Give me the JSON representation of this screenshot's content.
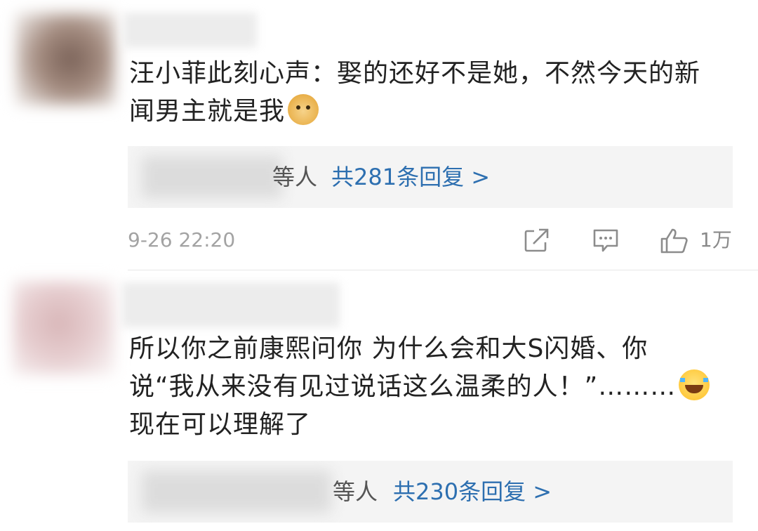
{
  "comments": [
    {
      "text_line1": "汪小菲此刻心声：娶的还好不是她，不然今天的新",
      "text_line2": "闻男主就是我",
      "emoji": "doge-emoji",
      "reply_suffix": "等人",
      "reply_count": "共281条回复 >",
      "timestamp": "9-26 22:20",
      "like_count": "1万"
    },
    {
      "text_line1": "所以你之前康熙问你 为什么会和大S闪婚、你",
      "text_line2": "说“我从来没有见过说话这么温柔的人！”………",
      "text_line3": "现在可以理解了",
      "emoji": "laughing-tears-emoji",
      "reply_suffix": "等人",
      "reply_count": "共230条回复 >"
    }
  ],
  "icons": {
    "share": "share-icon",
    "comment": "comment-icon",
    "like": "thumbs-up-icon"
  },
  "colors": {
    "link": "#2d6fb0",
    "muted": "#a3a3a3",
    "reply_bg": "#f4f4f4"
  }
}
